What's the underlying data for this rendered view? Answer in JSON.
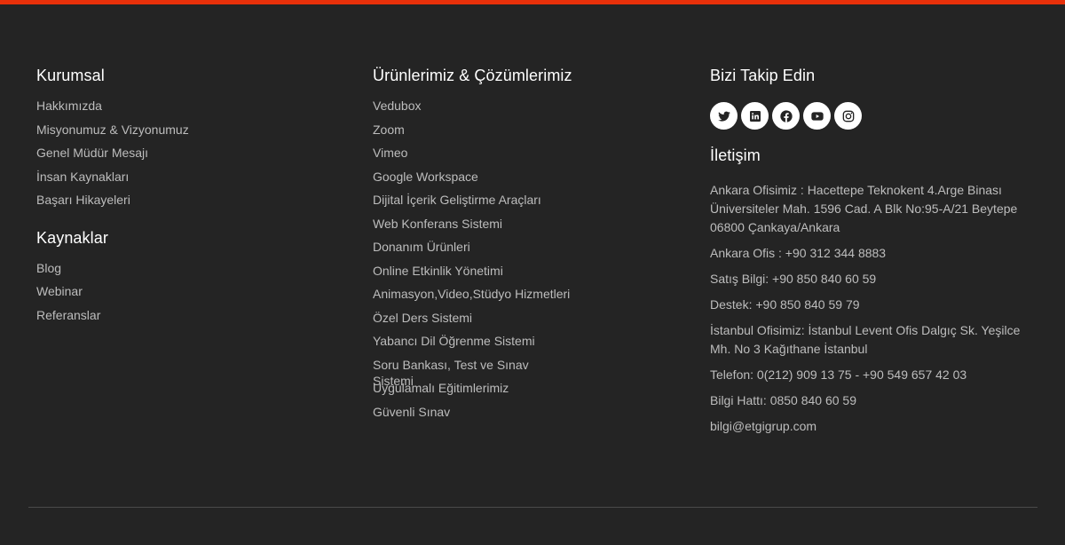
{
  "footer": {
    "kurumsal": {
      "title": "Kurumsal",
      "links": [
        "Hakkımızda",
        "Misyonumuz & Vizyonumuz",
        "Genel Müdür Mesajı",
        "İnsan Kaynakları",
        "Başarı Hikayeleri"
      ]
    },
    "kaynaklar": {
      "title": "Kaynaklar",
      "links": [
        "Blog",
        "Webinar",
        "Referanslar"
      ]
    },
    "products": {
      "title": "Ürünlerimiz & Çözümlerimiz",
      "links": [
        "Vedubox",
        "Zoom",
        "Vimeo",
        "Google Workspace",
        "Dijital İçerik Geliştirme Araçları",
        "Web Konferans Sistemi",
        "Donanım Ürünleri",
        "Online Etkinlik Yönetimi",
        "Animasyon,Video,Stüdyo Hizmetleri",
        "Özel Ders Sistemi",
        "Yabancı Dil Öğrenme Sistemi",
        "Soru Bankası, Test ve Sınav Sistemi",
        "Uygulamalı Eğitimlerimiz",
        "Güvenli Sınav"
      ]
    },
    "follow": {
      "title": "Bizi Takip Edin",
      "icons": [
        "twitter-icon",
        "linkedin-icon",
        "facebook-icon",
        "youtube-icon",
        "instagram-icon"
      ]
    },
    "contact": {
      "title": "İletişim",
      "lines": [
        "Ankara Ofisimiz : Hacettepe Teknokent 4.Arge Binası Üniversiteler Mah. 1596 Cad. A Blk No:95-A/21 Beytepe 06800 Çankaya/Ankara",
        "Ankara Ofis : +90 312 344 8883",
        "Satış Bilgi: +90 850 840 60 59",
        "Destek: +90 850 840 59 79",
        "İstanbul Ofisimiz: İstanbul Levent Ofis Dalgıç Sk. Yeşilce Mh. No 3 Kağıthane İstanbul",
        "Telefon: 0(212) 909 13 75 - +90 549 657 42 03",
        "Bilgi Hattı: 0850 840 60 59",
        "bilgi@etgigrup.com"
      ]
    },
    "colors": {
      "accent": "#e8300a",
      "background": "#242424"
    }
  }
}
